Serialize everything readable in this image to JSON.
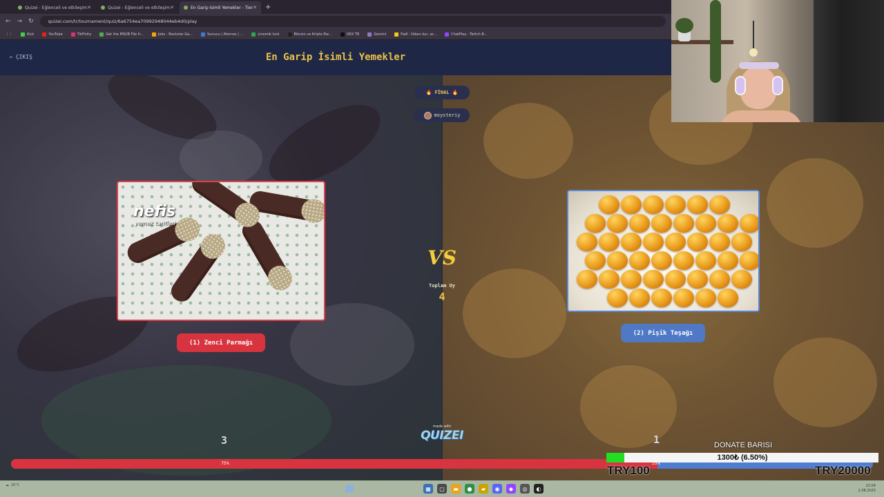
{
  "browser": {
    "tabs": [
      {
        "label": "Quizei - Eğlenceli ve etkileşimli",
        "active": false
      },
      {
        "label": "Quizei - Eğlenceli ve etkileşimli",
        "active": false
      },
      {
        "label": "En Garip İsimli Yemekler - Tier",
        "active": true
      }
    ],
    "new_tab": "+",
    "url": "quizei.com/tr/tournament/quiz/6a6754ea70992948044eb4d0/play",
    "bookmarks": [
      {
        "label": "Kick",
        "color": "#3fd14a"
      },
      {
        "label": "YouTube",
        "color": "#e62117"
      },
      {
        "label": "TikFinity",
        "color": "#e0306a"
      },
      {
        "label": "Get the MSUB File fr...",
        "color": "#4caf50"
      },
      {
        "label": "Jobs - Rockstar Ga...",
        "color": "#f2a900"
      },
      {
        "label": "Sunucu | Aternos | ...",
        "color": "#3a7bd5"
      },
      {
        "label": "cinemik lock",
        "color": "#2ba84a"
      },
      {
        "label": "Bitcoin ve Kripto Par...",
        "color": "#222222"
      },
      {
        "label": "OKX TR",
        "color": "#111111"
      },
      {
        "label": "Gemini",
        "color": "#8e7cc3"
      },
      {
        "label": "Fadl - Odanı kur, ar...",
        "color": "#f5c518"
      },
      {
        "label": "ChatPlay - Twitch B...",
        "color": "#9146ff"
      }
    ]
  },
  "site": {
    "exit_label": "ÇIKIŞ",
    "title": "En Garip İsimli Yemekler"
  },
  "match": {
    "stage_label": "FİNAL",
    "stage_icon_left": "🔥",
    "stage_icon_right": "🔥",
    "username": "moysteriy",
    "vs_text": "VS",
    "total_votes_label": "Toplam Oy",
    "total_votes": "4",
    "option1": {
      "button_label": "(1) Zenci Parmağı",
      "image_brand": "nefis",
      "image_brand_sub": "yemek tarifleri",
      "score": "3",
      "percent_label": "75%",
      "share": 0.75
    },
    "option2": {
      "button_label": "(2) Pişik Teşağı",
      "score": "1",
      "percent_label": "25%"
    },
    "made_with": "made with",
    "logo": "QUIZEI"
  },
  "donation": {
    "title": "DONATE BARISI",
    "amount": "1300₺ (6.50%)",
    "progress": 0.065,
    "min": "TRY100",
    "max": "TRY20000"
  },
  "taskbar": {
    "weather": "20°C",
    "time": "22:04",
    "date": "2.08.2025"
  },
  "colors": {
    "accent_title": "#e9c24a",
    "option1": "#d8343f",
    "option2": "#4f79c4",
    "donate_fill": "#22dd22"
  }
}
